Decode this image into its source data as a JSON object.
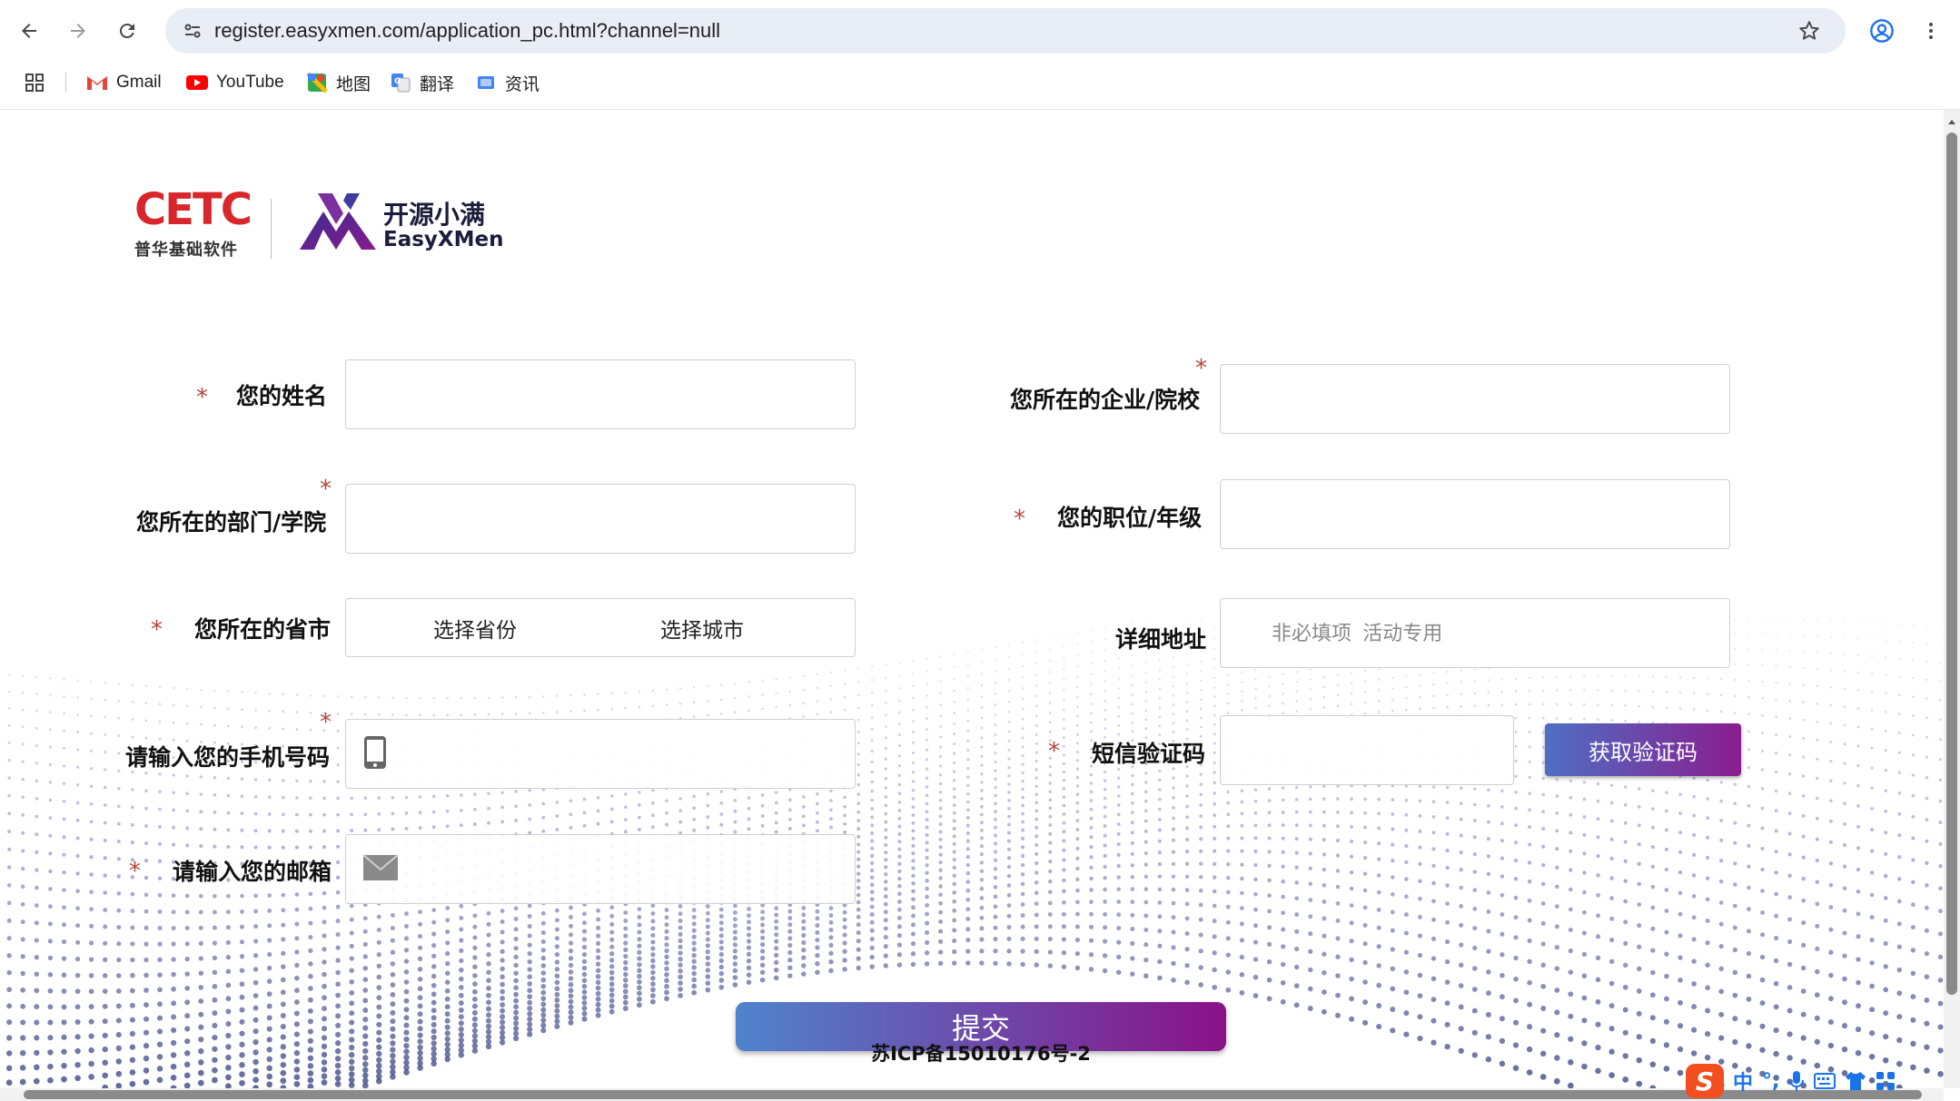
{
  "browser": {
    "url": "register.easyxmen.com/application_pc.html?channel=null",
    "bookmarks": [
      {
        "label": "Gmail",
        "icon": "gmail-icon"
      },
      {
        "label": "YouTube",
        "icon": "youtube-icon"
      },
      {
        "label": "地图",
        "icon": "maps-icon"
      },
      {
        "label": "翻译",
        "icon": "translate-icon"
      },
      {
        "label": "资讯",
        "icon": "news-icon"
      }
    ]
  },
  "logos": {
    "cetc_word": "CETC",
    "cetc_sub": "普华基础软件",
    "xmen_cn": "开源小满",
    "xmen_en": "EasyXMen"
  },
  "form": {
    "required_mark": "*",
    "name_label": "您的姓名",
    "company_label": "您所在的企业/院校",
    "dept_label": "您所在的部门/学院",
    "position_label": "您的职位/年级",
    "region_label": "您所在的省市",
    "province_select": "选择省份",
    "city_select": "选择城市",
    "address_label": "详细地址",
    "address_placeholder": "非必填项  活动专用",
    "phone_label": "请输入您的手机号码",
    "sms_label": "短信验证码",
    "get_code_button": "获取验证码",
    "email_label": "请输入您的邮箱",
    "submit_button": "提交",
    "icp": "苏ICP备15010176号-2"
  },
  "ime": {
    "mode": "中",
    "punct": "°,"
  },
  "colors": {
    "required": "#b5443a",
    "button_gradient_start": "#4e6fc4",
    "button_gradient_end": "#8a1d8e",
    "cetc_red": "#d8262a"
  }
}
